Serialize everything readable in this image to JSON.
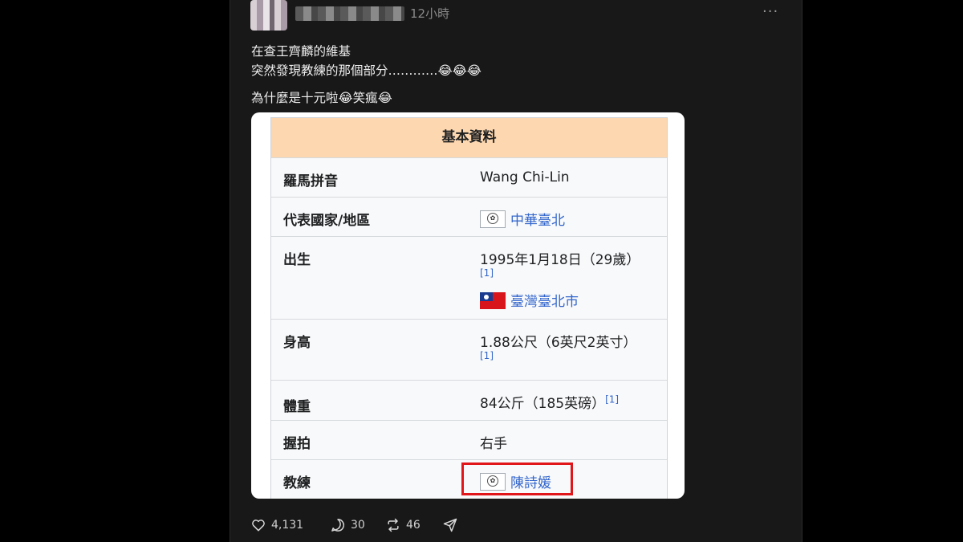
{
  "post": {
    "time": "12小時",
    "more": "···",
    "line1": "在查王齊麟的維基",
    "line2": "突然發現教練的那個部分…………😂😂😂",
    "line3": "為什麼是十元啦😂笑瘋😂"
  },
  "infobox": {
    "header": "基本資料",
    "rows": [
      {
        "label": "羅馬拼音",
        "value": "Wang Chi-Lin"
      },
      {
        "label": "代表國家/地區",
        "value": "中華臺北"
      },
      {
        "label": "出生",
        "value": "1995年1月18日（29歲）",
        "ref": "[1]",
        "place": "臺灣臺北市"
      },
      {
        "label": "身高",
        "value": "1.88公尺（6英尺2英寸）",
        "ref": "[1]"
      },
      {
        "label": "體重",
        "value": "84公斤（185英磅）",
        "ref": "[1]"
      },
      {
        "label": "握拍",
        "value": "右手"
      },
      {
        "label": "教練",
        "value": "陳詩媛"
      }
    ]
  },
  "actions": {
    "likes": "4,131",
    "comments": "30",
    "reposts": "46"
  },
  "colors": {
    "header_bg": "#fcd7b0",
    "link": "#3366cc",
    "highlight": "#e0161b"
  }
}
